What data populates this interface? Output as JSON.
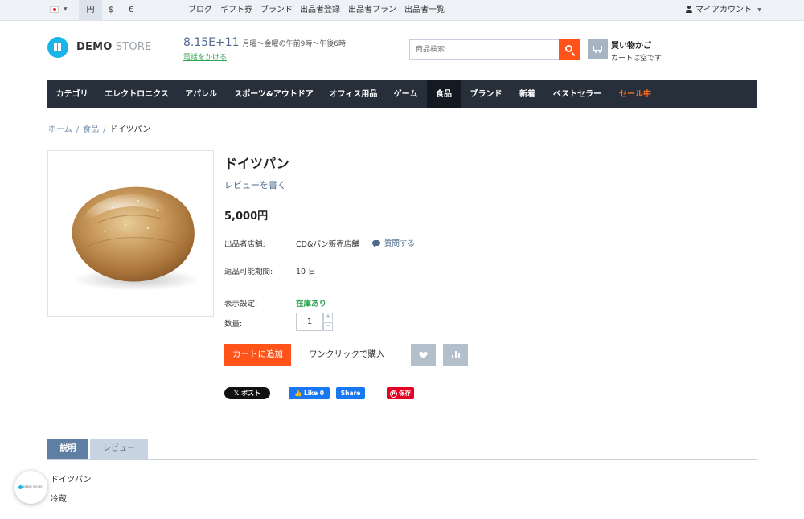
{
  "topbar": {
    "currencies": [
      "円",
      "$",
      "€"
    ],
    "links": [
      "ブログ",
      "ギフト券",
      "ブランド",
      "出品者登録",
      "出品者プラン",
      "出品者一覧"
    ],
    "account": "マイアカウント"
  },
  "header": {
    "logo_bold": "DEMO",
    "logo_light": "STORE",
    "phone": "8.15E+11",
    "hours": "月曜〜金曜の午前9時〜午後6時",
    "call_link": "電話をかける",
    "search_placeholder": "商品検索",
    "cart_title": "買い物かご",
    "cart_status": "カートは空です"
  },
  "nav": [
    "カテゴリ",
    "エレクトロニクス",
    "アパレル",
    "スポーツ&アウトドア",
    "オフィス用品",
    "ゲーム",
    "食品",
    "ブランド",
    "新着",
    "ベストセラー",
    "セール中"
  ],
  "breadcrumb": {
    "home": "ホーム",
    "category": "食品",
    "current": "ドイツパン",
    "separator": "/"
  },
  "product": {
    "title": "ドイツパン",
    "review_link": "レビューを書く",
    "price": "5,000",
    "currency": "円",
    "vendor_label": "出品者店舗:",
    "vendor": "CD&パン販売店舗",
    "ask": "質問する",
    "return_label": "返品可能期間:",
    "return_value": "10 日",
    "availability_label": "表示設定:",
    "availability": "在庫あり",
    "qty_label": "数量:",
    "qty": "1",
    "add_to_cart": "カートに追加",
    "one_click": "ワンクリックで購入"
  },
  "social": {
    "x": "ポスト",
    "like": "Like 0",
    "share": "Share",
    "pin": "保存"
  },
  "tabs": [
    "説明",
    "レビュー"
  ],
  "description": [
    "ドイツパン",
    "冷蔵"
  ],
  "colors": {
    "accent": "#ff5319",
    "nav_bg": "#262f3a",
    "link": "#4e6a8e",
    "in_stock": "#2ea44f"
  }
}
